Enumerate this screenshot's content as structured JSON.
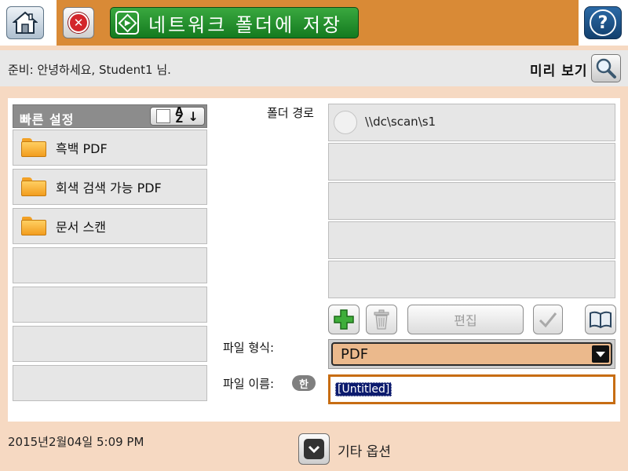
{
  "header": {
    "title": "네트워크 폴더에 저장",
    "home_icon": "home-icon",
    "stop_icon": "stop-icon",
    "start_icon": "start-icon",
    "help_glyph": "?",
    "colors": {
      "bar": "#d98a36",
      "start": "#1f8a2a",
      "stop": "#d3262b",
      "help": "#1d4f82"
    }
  },
  "status": {
    "message": "준비: 안녕하세요, Student1 님.",
    "preview_label": "미리 보기"
  },
  "quick_sets": {
    "title": "빠른 설정",
    "items": [
      {
        "label": "흑백 PDF"
      },
      {
        "label": "회색 검색 가능 PDF"
      },
      {
        "label": "문서 스캔"
      }
    ]
  },
  "folder_path": {
    "label": "폴더 경로",
    "paths": [
      "\\\\dc\\scan\\s1"
    ]
  },
  "toolbar": {
    "add_icon": "plus-icon",
    "delete_icon": "trash-icon",
    "edit_label": "편집",
    "check_icon": "checkmark-icon",
    "address_book_icon": "book-icon"
  },
  "file_format": {
    "label": "파일 형식:",
    "value": "PDF"
  },
  "file_name": {
    "label": "파일 이름:",
    "ime_badge": "한",
    "value": "[Untitled]"
  },
  "footer": {
    "datetime": "2015년2월04일 5:09 PM",
    "more_options_label": "기타 옵션"
  }
}
